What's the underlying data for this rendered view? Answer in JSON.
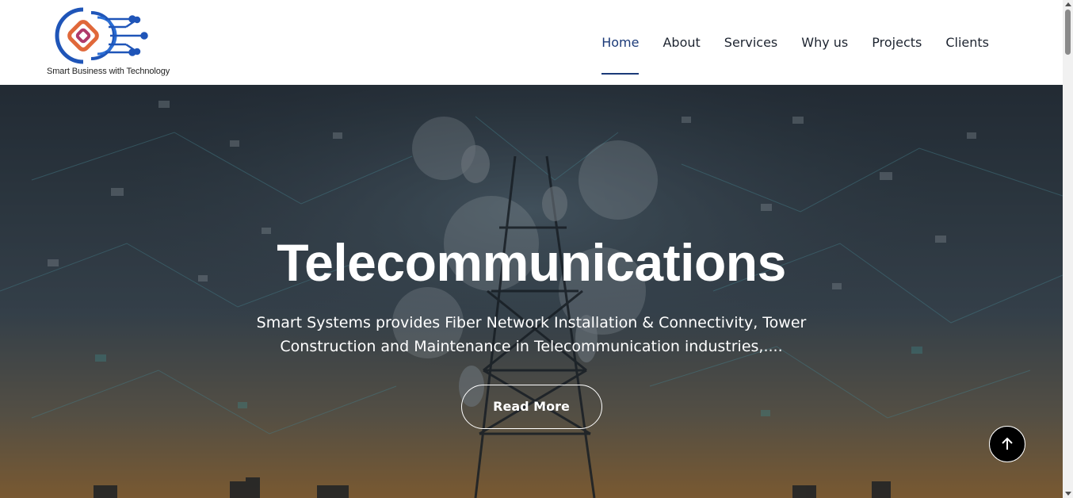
{
  "header": {
    "logo_tagline": "Smart Business with Technology",
    "nav": [
      {
        "label": "Home",
        "active": true
      },
      {
        "label": "About",
        "active": false
      },
      {
        "label": "Services",
        "active": false
      },
      {
        "label": "Why us",
        "active": false
      },
      {
        "label": "Projects",
        "active": false
      },
      {
        "label": "Clients",
        "active": false
      }
    ]
  },
  "hero": {
    "title": "Telecommunications",
    "description": "Smart Systems provides Fiber Network Installation & Connectivity, Tower Construction and Maintenance in Telecommunication industries,....",
    "button_label": "Read More"
  },
  "icons": {
    "back_to_top": "arrow-up-icon",
    "logo": "circuit-logo-icon"
  },
  "colors": {
    "nav_active": "#1b3a78",
    "logo_blue": "#1f55b8",
    "logo_orange": "#e0683a",
    "logo_magenta": "#b03a6a"
  }
}
